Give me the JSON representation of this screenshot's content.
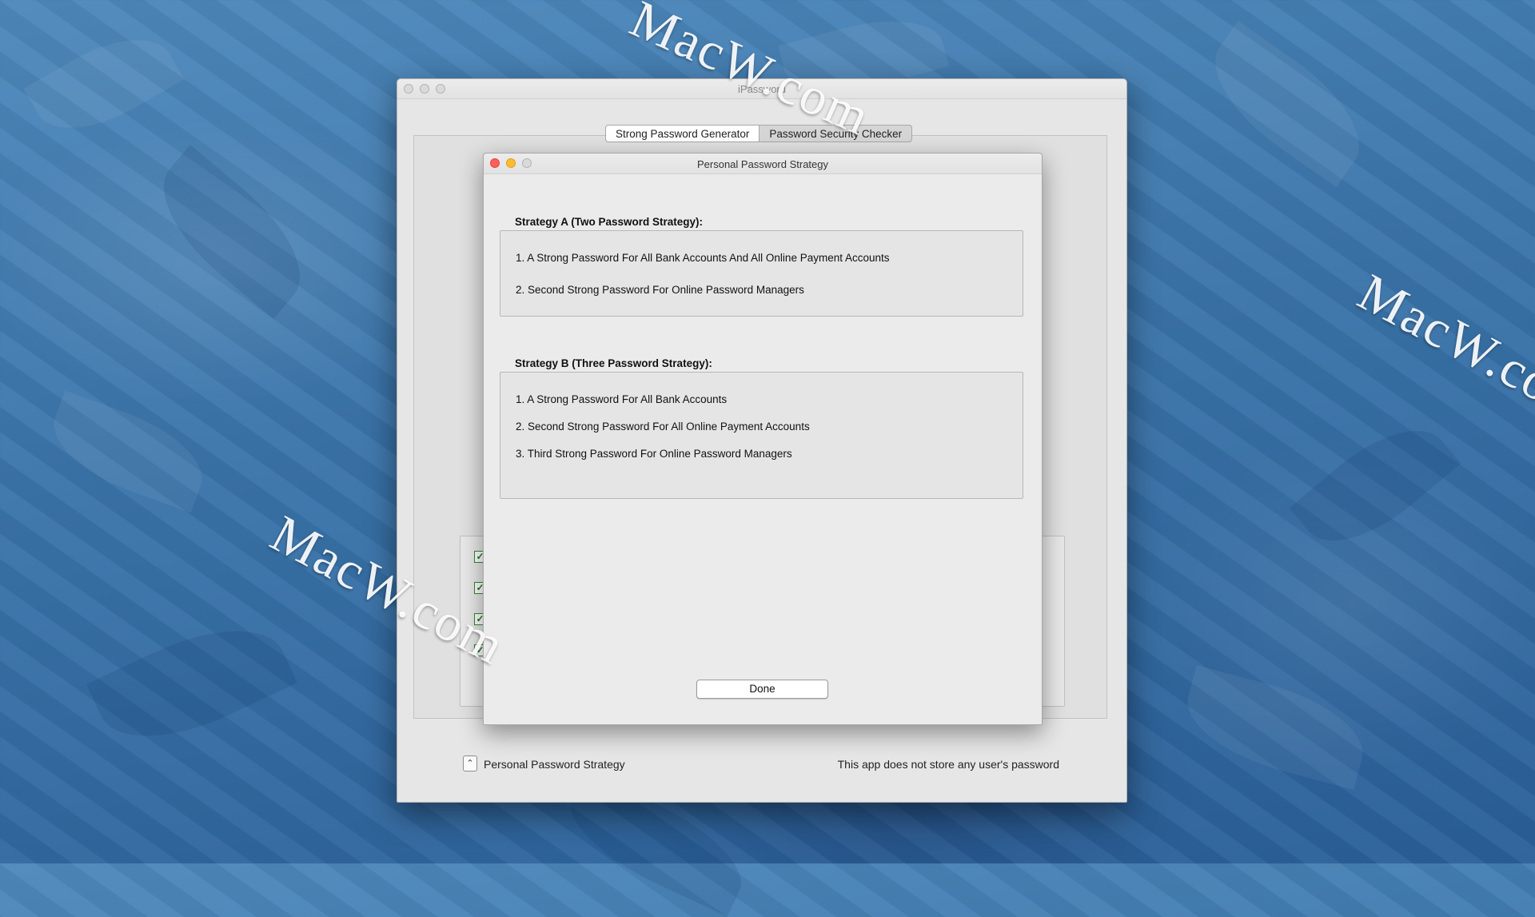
{
  "desktop": {
    "watermark": "MacW.com"
  },
  "main_window": {
    "title": "iPassword",
    "tabs": [
      {
        "label": "Strong Password Generator",
        "selected": true
      },
      {
        "label": "Password Security Checker",
        "selected": false
      }
    ],
    "footer": {
      "strategy_button_label": "Personal Password Strategy",
      "note": "This app does not store any user's password"
    }
  },
  "sheet": {
    "title": "Personal Password Strategy",
    "strategy_a": {
      "title": "Strategy A (Two Password Strategy):",
      "items": [
        "1. A Strong Password For All Bank Accounts And All Online Payment Accounts",
        "2. Second Strong Password For Online Password Managers"
      ]
    },
    "strategy_b": {
      "title": "Strategy B (Three Password Strategy):",
      "items": [
        "1. A Strong Password For All Bank Accounts",
        "2. Second Strong Password For All Online Payment Accounts",
        "3. Third Strong Password For Online Password Managers"
      ]
    },
    "done_label": "Done"
  },
  "colors": {
    "close": "#fc5f57",
    "minimize": "#fdbc2e",
    "checkbox": "#2f8a2f"
  }
}
